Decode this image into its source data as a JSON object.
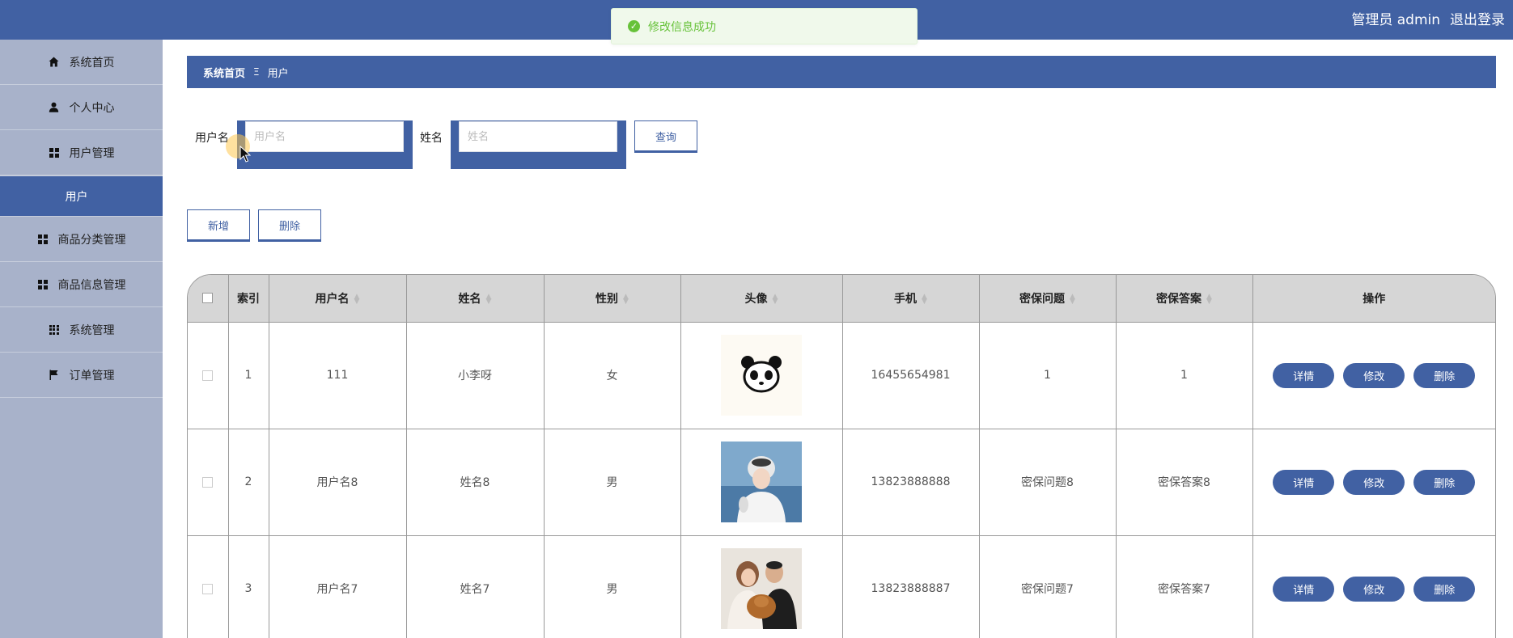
{
  "header": {
    "user_label": "管理员 admin",
    "logout_label": "退出登录"
  },
  "toast": {
    "message": "修改信息成功"
  },
  "sidebar": {
    "items": [
      {
        "label": "系统首页",
        "icon": "home-icon"
      },
      {
        "label": "个人中心",
        "icon": "user-icon"
      },
      {
        "label": "用户管理",
        "icon": "grid-icon"
      },
      {
        "label": "用户",
        "icon": ""
      },
      {
        "label": "商品分类管理",
        "icon": "grid-icon"
      },
      {
        "label": "商品信息管理",
        "icon": "grid-icon"
      },
      {
        "label": "系统管理",
        "icon": "apps-icon"
      },
      {
        "label": "订单管理",
        "icon": "flag-icon"
      }
    ]
  },
  "breadcrumb": {
    "home": "系统首页",
    "separator": "Ξ",
    "current": "用户"
  },
  "search": {
    "username_label": "用户名",
    "username_placeholder": "用户名",
    "name_label": "姓名",
    "name_placeholder": "姓名",
    "query_label": "查询"
  },
  "actions": {
    "add_label": "新增",
    "delete_label": "删除"
  },
  "table": {
    "columns": [
      "索引",
      "用户名",
      "姓名",
      "性别",
      "头像",
      "手机",
      "密保问题",
      "密保答案",
      "操作"
    ],
    "op_labels": {
      "detail": "详情",
      "edit": "修改",
      "delete": "删除"
    },
    "rows": [
      {
        "index": "1",
        "username": "111",
        "name": "小李呀",
        "gender": "女",
        "avatar": "panda-avatar",
        "phone": "16455654981",
        "question": "1",
        "answer": "1"
      },
      {
        "index": "2",
        "username": "用户名8",
        "name": "姓名8",
        "gender": "男",
        "avatar": "photo-avatar",
        "phone": "13823888888",
        "question": "密保问题8",
        "answer": "密保答案8"
      },
      {
        "index": "3",
        "username": "用户名7",
        "name": "姓名7",
        "gender": "男",
        "avatar": "photo-avatar",
        "phone": "13823888887",
        "question": "密保问题7",
        "answer": "密保答案7"
      }
    ]
  },
  "colors": {
    "primary": "#4161a3",
    "sidebar_bg": "#a8b2ca",
    "success": "#67c23a"
  }
}
